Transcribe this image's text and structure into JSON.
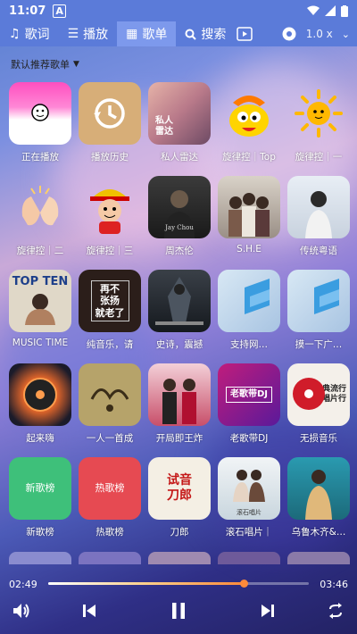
{
  "status": {
    "time": "11:07"
  },
  "toolbar": {
    "tabs": [
      {
        "label": "歌词"
      },
      {
        "label": "播放"
      },
      {
        "label": "歌单"
      },
      {
        "label": "搜索"
      }
    ],
    "speed": "1.0 x"
  },
  "subheader": {
    "title": "默认推荐歌单"
  },
  "playlists": [
    {
      "label": "正在播放"
    },
    {
      "label": "播放历史"
    },
    {
      "label": "私人雷达",
      "cover_text": "私人\n雷达"
    },
    {
      "label": "旋律控｜Top"
    },
    {
      "label": "旋律控｜一"
    },
    {
      "label": "旋律控｜二"
    },
    {
      "label": "旋律控｜三"
    },
    {
      "label": "周杰伦"
    },
    {
      "label": "S.H.E"
    },
    {
      "label": "传统粤语"
    },
    {
      "label": "MUSIC TIME",
      "cover_text": "TOP TEN"
    },
    {
      "label": "纯音乐，请",
      "cover_text": "再不\n张扬\n就老了"
    },
    {
      "label": "史诗，震撼"
    },
    {
      "label": "支持网…"
    },
    {
      "label": "摸一下广…"
    },
    {
      "label": "起来嗨"
    },
    {
      "label": "一人一首成"
    },
    {
      "label": "开局即王炸"
    },
    {
      "label": "老歌带DJ",
      "cover_text": "老歌带DJ"
    },
    {
      "label": "无损音乐",
      "cover_text": "经典流行\n唱片行"
    },
    {
      "label": "新歌榜",
      "cover_text": "新歌榜"
    },
    {
      "label": "热歌榜",
      "cover_text": "热歌榜"
    },
    {
      "label": "刀郎",
      "cover_text": "试音\n刀郎"
    },
    {
      "label": "滚石唱片｜",
      "cover_text": "滚石唱片"
    },
    {
      "label": "乌鲁木齐&…"
    }
  ],
  "player": {
    "current_time": "02:49",
    "total_time": "03:46",
    "progress": 0.75
  },
  "colors": {
    "toolbar": "#5b7bd9",
    "active_tab": "#7d99ec",
    "progress_accent": "#ff8a3a"
  }
}
